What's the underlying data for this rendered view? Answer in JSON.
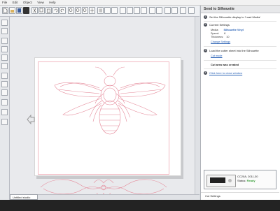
{
  "menu": {
    "items": [
      "File",
      "Edit",
      "Object",
      "View",
      "Help"
    ]
  },
  "panel": {
    "title": "Send to Silhouette",
    "step1": "Set the Silhouette display to 'Load Media'",
    "step2_title": "Current Settings",
    "media_label": "Media:",
    "media_value": "Silhouette Vinyl",
    "speed_label": "Speed:",
    "speed_value": "8",
    "thickness_label": "Thickness:",
    "thickness_value": "10",
    "change_link": "Change Settings",
    "step3": "Load the cutter sheet into the Silhouette",
    "cut_mode": "Cut mode",
    "step4": "Cut area was created",
    "close_text": "Click here to close window"
  },
  "device": {
    "model": "CC20A, 2011-30",
    "status_label": "Status:",
    "status_value": "Ready"
  },
  "footer": {
    "cut_settings": "Cut Settings"
  },
  "workspace": {
    "doc_tab": "Untitled studio"
  },
  "colors": {
    "cut_line": "#f1b8c1",
    "art": "#e58a9a",
    "ready": "#3a9f3a",
    "link": "#2b63b6"
  }
}
